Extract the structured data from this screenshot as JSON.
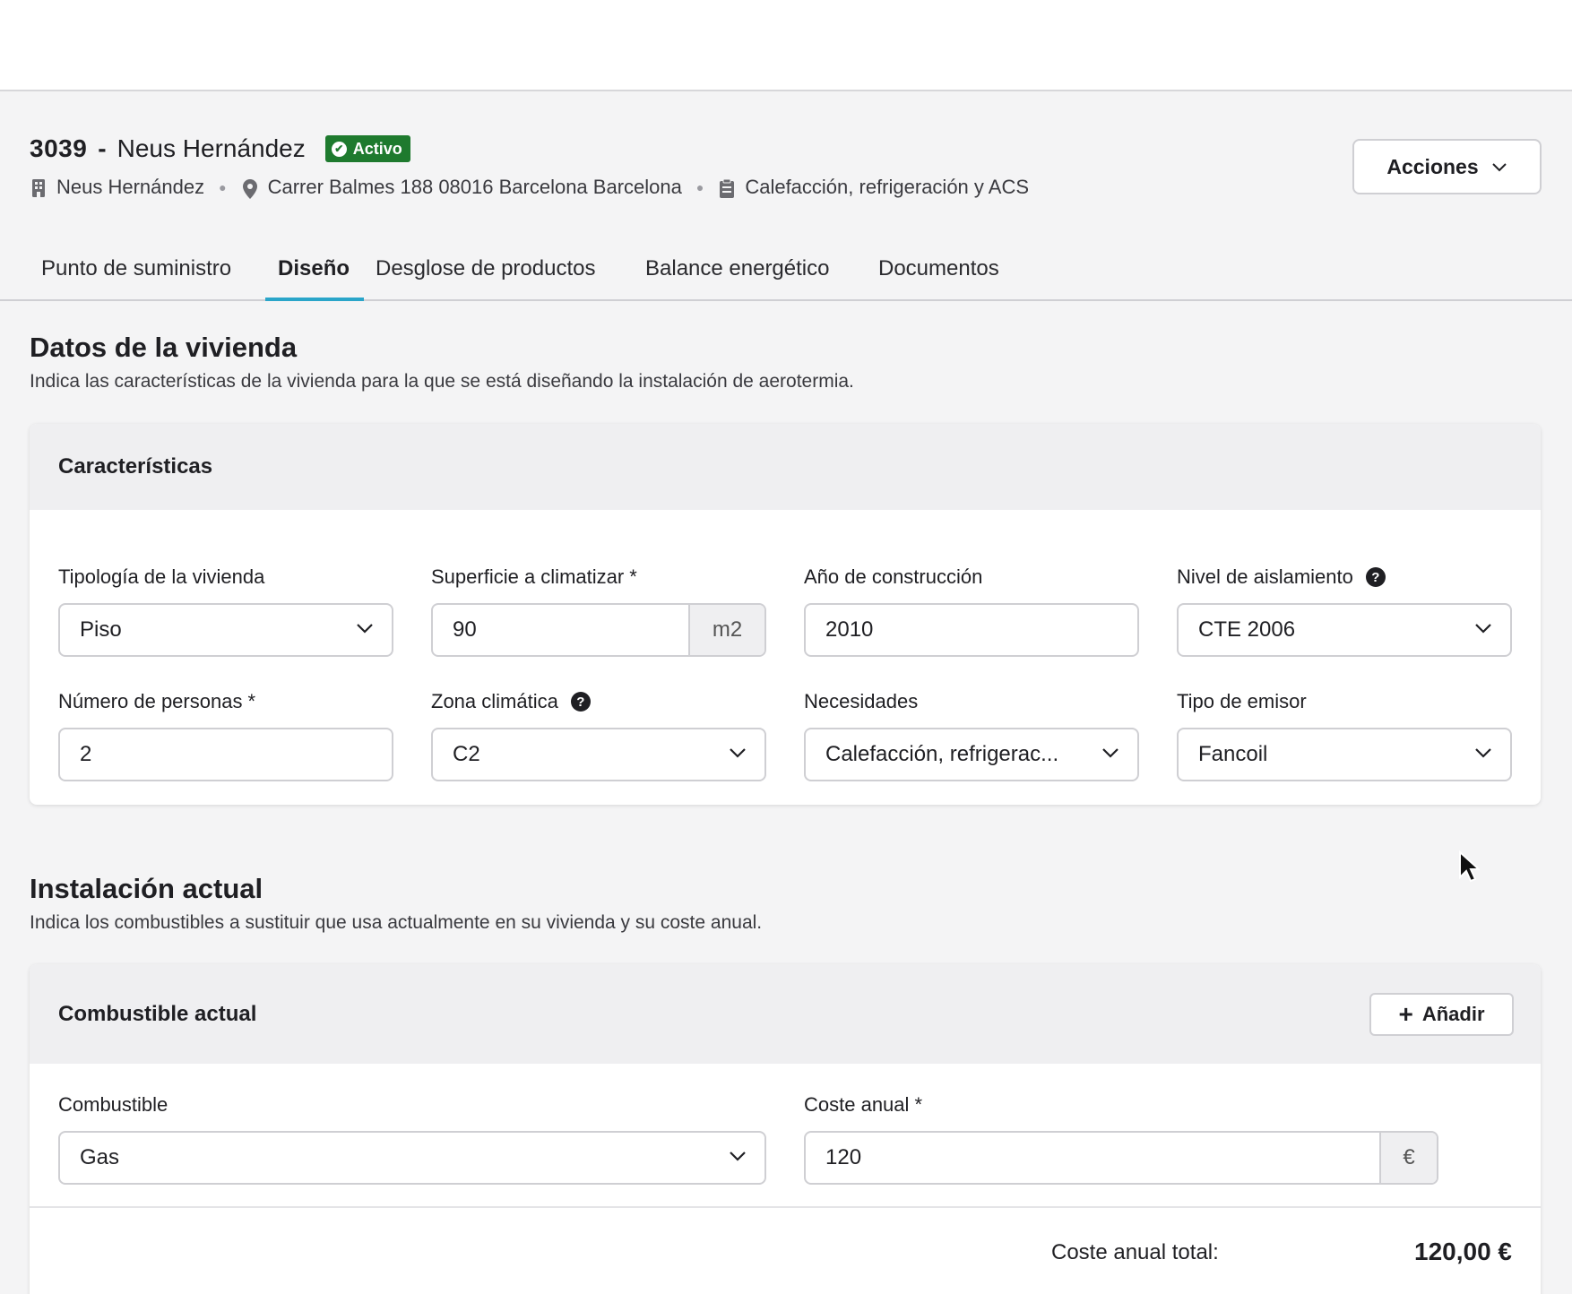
{
  "header": {
    "id": "3039",
    "separator": "-",
    "name": "Neus Hernández",
    "status": "Activo",
    "client": "Neus Hernández",
    "address": "Carrer Balmes 188 08016 Barcelona Barcelona",
    "service": "Calefacción, refrigeración y ACS",
    "actions_label": "Acciones"
  },
  "tabs": [
    {
      "label": "Punto de suministro"
    },
    {
      "label": "Diseño",
      "active": true
    },
    {
      "label": "Desglose de productos"
    },
    {
      "label": "Balance energético"
    },
    {
      "label": "Documentos"
    }
  ],
  "vivienda": {
    "title": "Datos de la vivienda",
    "description": "Indica las características de la vivienda para la que se está diseñando la instalación de aerotermia.",
    "card_title": "Características",
    "fields": {
      "tipologia": {
        "label": "Tipología de la vivienda",
        "value": "Piso"
      },
      "superficie": {
        "label": "Superficie a climatizar *",
        "value": "90",
        "unit": "m2"
      },
      "anio": {
        "label": "Año de construcción",
        "value": "2010"
      },
      "aislamiento": {
        "label": "Nivel de aislamiento",
        "value": "CTE 2006"
      },
      "personas": {
        "label": "Número de personas *",
        "value": "2"
      },
      "zona": {
        "label": "Zona climática",
        "value": "C2"
      },
      "necesidades": {
        "label": "Necesidades",
        "value": "Calefacción, refrigerac..."
      },
      "emisor": {
        "label": "Tipo de emisor",
        "value": "Fancoil"
      }
    }
  },
  "instalacion": {
    "title": "Instalación actual",
    "description": "Indica los combustibles a sustituir que usa actualmente en su vivienda y su coste anual.",
    "card_title": "Combustible actual",
    "add_label": "Añadir",
    "combustible": {
      "label": "Combustible",
      "value": "Gas"
    },
    "coste": {
      "label": "Coste anual *",
      "value": "120",
      "unit": "€"
    },
    "total_label": "Coste anual total:",
    "total_value": "120,00 €"
  },
  "icons": {
    "check": "✔",
    "help": "?",
    "plus": "+"
  }
}
